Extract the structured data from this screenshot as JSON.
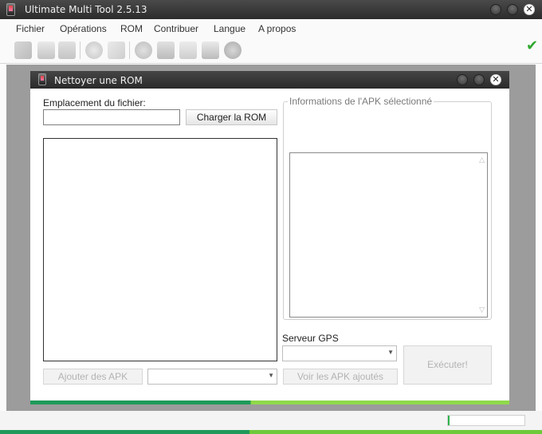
{
  "app": {
    "title": "Ultimate Multi Tool 2.5.13"
  },
  "menu": [
    "Fichier",
    "Opérations",
    "ROM",
    "Contribuer",
    "Langue",
    "A propos"
  ],
  "dialog": {
    "title": "Nettoyer une ROM",
    "file_label": "Emplacement du fichier:",
    "file_value": "",
    "load_button": "Charger la ROM",
    "apk_info_legend": "Informations de l'APK sélectionné",
    "gps_label": "Serveur GPS",
    "gps_value": "",
    "execute_button": "Exécuter!",
    "add_apk_button": "Ajouter des APK",
    "view_apk_button": "Voir les APK ajoutés",
    "apk_combo_value": ""
  },
  "status": {
    "progress": 0.02
  },
  "colors": {
    "accent_green": "#2fa82f",
    "stripe_dark": "#1f9a5a",
    "stripe_light": "#8fd94a",
    "titlebar": "#333333"
  }
}
